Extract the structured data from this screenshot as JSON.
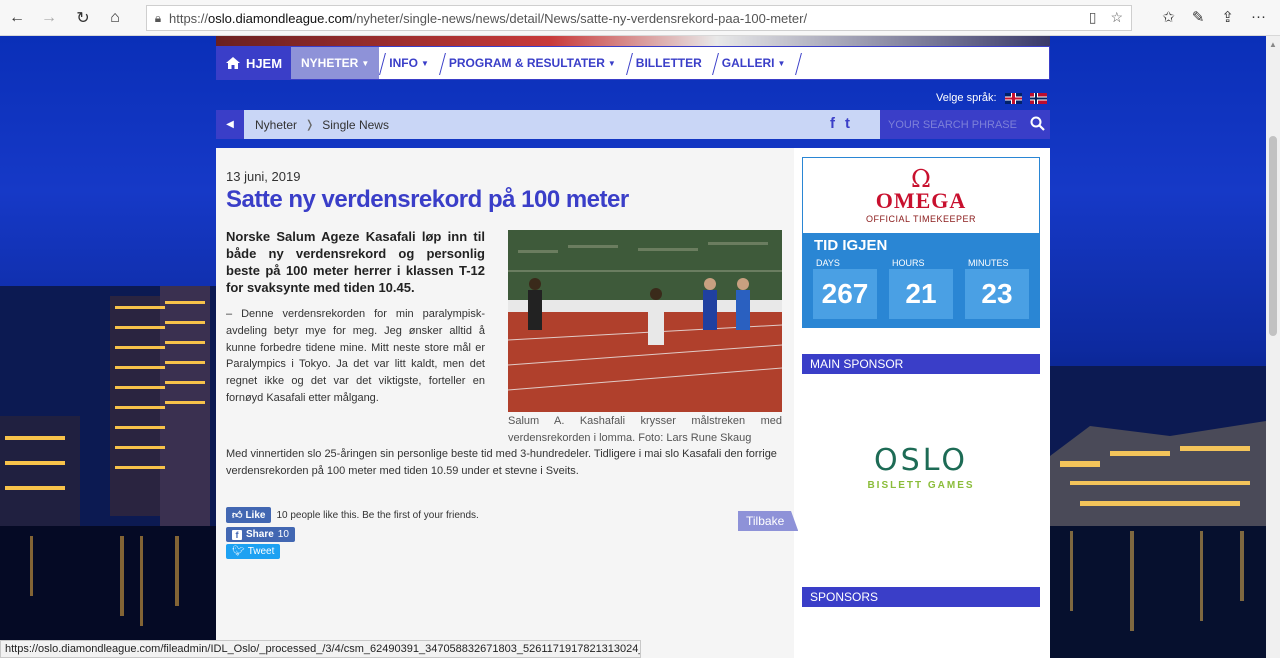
{
  "browser": {
    "url_scheme": "https://",
    "url_host": "oslo.diamondleague.com",
    "url_path": "/nyheter/single-news/news/detail/News/satte-ny-verdensrekord-paa-100-meter/",
    "status_url": "https://oslo.diamondleague.com/fileadmin/IDL_Oslo/_processed_/3/4/csm_62490391_347058832671803_5261171917821313024_n_34b5caa11d"
  },
  "nav": {
    "home": "HJEM",
    "items": [
      "NYHETER",
      "INFO",
      "PROGRAM & RESULTATER",
      "BILLETTER",
      "GALLERI"
    ]
  },
  "lang": {
    "label": "Velge språk:"
  },
  "breadcrumb": {
    "items": [
      "Nyheter",
      "Single News"
    ]
  },
  "search": {
    "placeholder": "YOUR SEARCH PHRASE"
  },
  "article": {
    "date": "13 juni, 2019",
    "title": "Satte ny verdensrekord på 100 meter",
    "lead": "Norske Salum Ageze Kasafali løp inn til både ny verdensrekord og personlig beste på 100 meter herrer i klassen T-12 for svaksynte med tiden 10.45.",
    "body1": "– Denne verdensrekorden for min paralympisk-avdeling betyr mye for meg. Jeg ønsker alltid å kunne forbedre tidene mine. Mitt neste store mål er Paralympics i Tokyo. Ja det var litt kaldt, men det regnet ikke og det var det viktigste, forteller en fornøyd Kasafali etter målgang.",
    "caption": "Salum A. Kashafali krysser målstreken med verdensrekorden i lomma. Foto: Lars Rune Skaug",
    "body2": "Med vinnertiden slo 25-åringen sin personlige beste tid med 3-hundredeler. Tidligere i mai slo Kasafali den forrige verdensrekorden på 100 meter med tiden 10.59 under et stevne i Sveits.",
    "back": "Tilbake"
  },
  "social": {
    "like": "Like",
    "like_text": "10 people like this. Be the first of your friends.",
    "share": "Share",
    "share_count": "10",
    "tweet": "Tweet"
  },
  "timer": {
    "brand": "OMEGA",
    "subtitle": "OFFICIAL TIMEKEEPER",
    "title": "TID IGJEN",
    "days_label": "DAYS",
    "days": "267",
    "hours_label": "HOURS",
    "hours": "21",
    "minutes_label": "MINUTES",
    "minutes": "23"
  },
  "sidebar": {
    "main_sponsor": "MAIN SPONSOR",
    "sponsor_name": "OSLO",
    "sponsor_sub": "BISLETT GAMES",
    "sponsors": "SPONSORS"
  },
  "colors": {
    "brand_blue": "#3a3ec8",
    "timer_blue": "#2a86d4",
    "omega_red": "#c8102e"
  }
}
